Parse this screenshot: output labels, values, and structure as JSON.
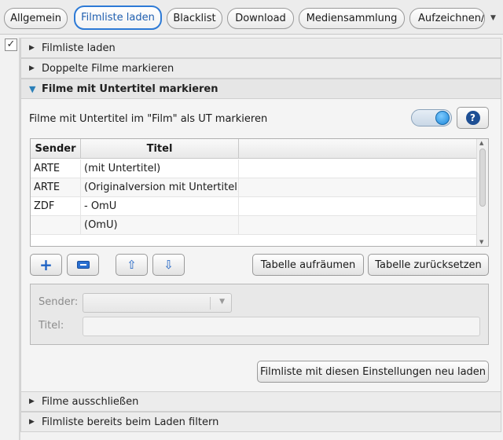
{
  "tabs": [
    {
      "label": "Allgemein",
      "active": false
    },
    {
      "label": "Filmliste laden",
      "active": true
    },
    {
      "label": "Blacklist",
      "active": false
    },
    {
      "label": "Download",
      "active": false
    },
    {
      "label": "Mediensammlung",
      "active": false
    },
    {
      "label": "Aufzeichnen/A",
      "active": false
    }
  ],
  "left_checkbox": {
    "mark": "✓",
    "checked": true
  },
  "sections": {
    "filmliste_laden": {
      "label": "Filmliste laden",
      "expanded": false
    },
    "doppelte_filme": {
      "label": "Doppelte Filme markieren",
      "expanded": false
    },
    "untertitel": {
      "label": "Filme mit Untertitel markieren",
      "expanded": true
    },
    "ausschliessen": {
      "label": "Filme ausschließen",
      "expanded": false
    },
    "filtern": {
      "label": "Filmliste bereits beim Laden filtern",
      "expanded": false
    }
  },
  "untertitel_panel": {
    "description": "Filme mit Untertitel im \"Film\" als UT markieren",
    "toggle_on": true,
    "help_label": "?",
    "table": {
      "columns": [
        "Sender",
        "Titel",
        ""
      ],
      "rows": [
        {
          "sender": "ARTE",
          "titel": "(mit Untertitel)"
        },
        {
          "sender": "ARTE",
          "titel": "(Originalversion mit Untertitel)"
        },
        {
          "sender": "ZDF",
          "titel": "- OmU"
        },
        {
          "sender": "",
          "titel": "(OmU)"
        }
      ]
    },
    "buttons": {
      "aufraeumen": "Tabelle aufräumen",
      "zuruecksetzen": "Tabelle zurücksetzen",
      "neu_laden": "Filmliste mit diesen Einstellungen neu laden"
    },
    "edit": {
      "sender_label": "Sender:",
      "sender_value": "",
      "titel_label": "Titel:",
      "titel_value": ""
    }
  },
  "colors": {
    "accent": "#2d7ad6",
    "toggle_knob": "#1b86d9",
    "help_icon": "#1e4f94"
  }
}
